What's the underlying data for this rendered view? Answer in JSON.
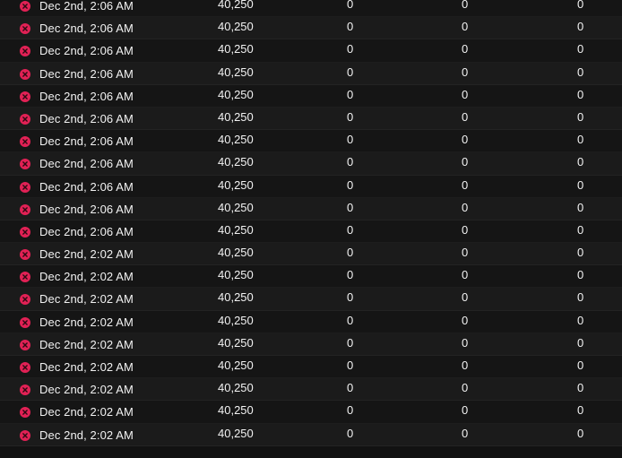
{
  "status_color": "#e12155",
  "status_icon": "close-icon",
  "rows": [
    {
      "date": "Dec 2nd, 2:06 AM",
      "amount": "40,250",
      "col2": "0",
      "col3": "0",
      "col4": "0"
    },
    {
      "date": "Dec 2nd, 2:06 AM",
      "amount": "40,250",
      "col2": "0",
      "col3": "0",
      "col4": "0"
    },
    {
      "date": "Dec 2nd, 2:06 AM",
      "amount": "40,250",
      "col2": "0",
      "col3": "0",
      "col4": "0"
    },
    {
      "date": "Dec 2nd, 2:06 AM",
      "amount": "40,250",
      "col2": "0",
      "col3": "0",
      "col4": "0"
    },
    {
      "date": "Dec 2nd, 2:06 AM",
      "amount": "40,250",
      "col2": "0",
      "col3": "0",
      "col4": "0"
    },
    {
      "date": "Dec 2nd, 2:06 AM",
      "amount": "40,250",
      "col2": "0",
      "col3": "0",
      "col4": "0"
    },
    {
      "date": "Dec 2nd, 2:06 AM",
      "amount": "40,250",
      "col2": "0",
      "col3": "0",
      "col4": "0"
    },
    {
      "date": "Dec 2nd, 2:06 AM",
      "amount": "40,250",
      "col2": "0",
      "col3": "0",
      "col4": "0"
    },
    {
      "date": "Dec 2nd, 2:06 AM",
      "amount": "40,250",
      "col2": "0",
      "col3": "0",
      "col4": "0"
    },
    {
      "date": "Dec 2nd, 2:06 AM",
      "amount": "40,250",
      "col2": "0",
      "col3": "0",
      "col4": "0"
    },
    {
      "date": "Dec 2nd, 2:06 AM",
      "amount": "40,250",
      "col2": "0",
      "col3": "0",
      "col4": "0"
    },
    {
      "date": "Dec 2nd, 2:02 AM",
      "amount": "40,250",
      "col2": "0",
      "col3": "0",
      "col4": "0"
    },
    {
      "date": "Dec 2nd, 2:02 AM",
      "amount": "40,250",
      "col2": "0",
      "col3": "0",
      "col4": "0"
    },
    {
      "date": "Dec 2nd, 2:02 AM",
      "amount": "40,250",
      "col2": "0",
      "col3": "0",
      "col4": "0"
    },
    {
      "date": "Dec 2nd, 2:02 AM",
      "amount": "40,250",
      "col2": "0",
      "col3": "0",
      "col4": "0"
    },
    {
      "date": "Dec 2nd, 2:02 AM",
      "amount": "40,250",
      "col2": "0",
      "col3": "0",
      "col4": "0"
    },
    {
      "date": "Dec 2nd, 2:02 AM",
      "amount": "40,250",
      "col2": "0",
      "col3": "0",
      "col4": "0"
    },
    {
      "date": "Dec 2nd, 2:02 AM",
      "amount": "40,250",
      "col2": "0",
      "col3": "0",
      "col4": "0"
    },
    {
      "date": "Dec 2nd, 2:02 AM",
      "amount": "40,250",
      "col2": "0",
      "col3": "0",
      "col4": "0"
    },
    {
      "date": "Dec 2nd, 2:02 AM",
      "amount": "40,250",
      "col2": "0",
      "col3": "0",
      "col4": "0"
    }
  ]
}
